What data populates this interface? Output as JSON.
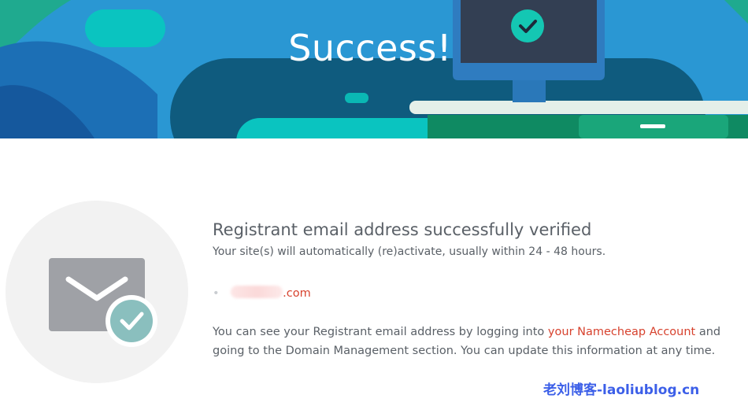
{
  "hero": {
    "title": "Success!"
  },
  "message": {
    "headline": "Registrant email address successfully verified",
    "subline": "Your site(s) will automatically (re)activate, usually within 24 - 48 hours.",
    "domain_suffix": ".com",
    "para_part1": "You can see your Registrant email address by logging into ",
    "account_link": "your Namecheap Account",
    "para_part2": " and going to the Domain Management section. You can update this information at any time."
  },
  "watermark": "老刘博客-laoliublog.cn",
  "colors": {
    "link": "#d7422e",
    "hero_blue": "#2a97d3",
    "teal": "#08c6b8"
  }
}
